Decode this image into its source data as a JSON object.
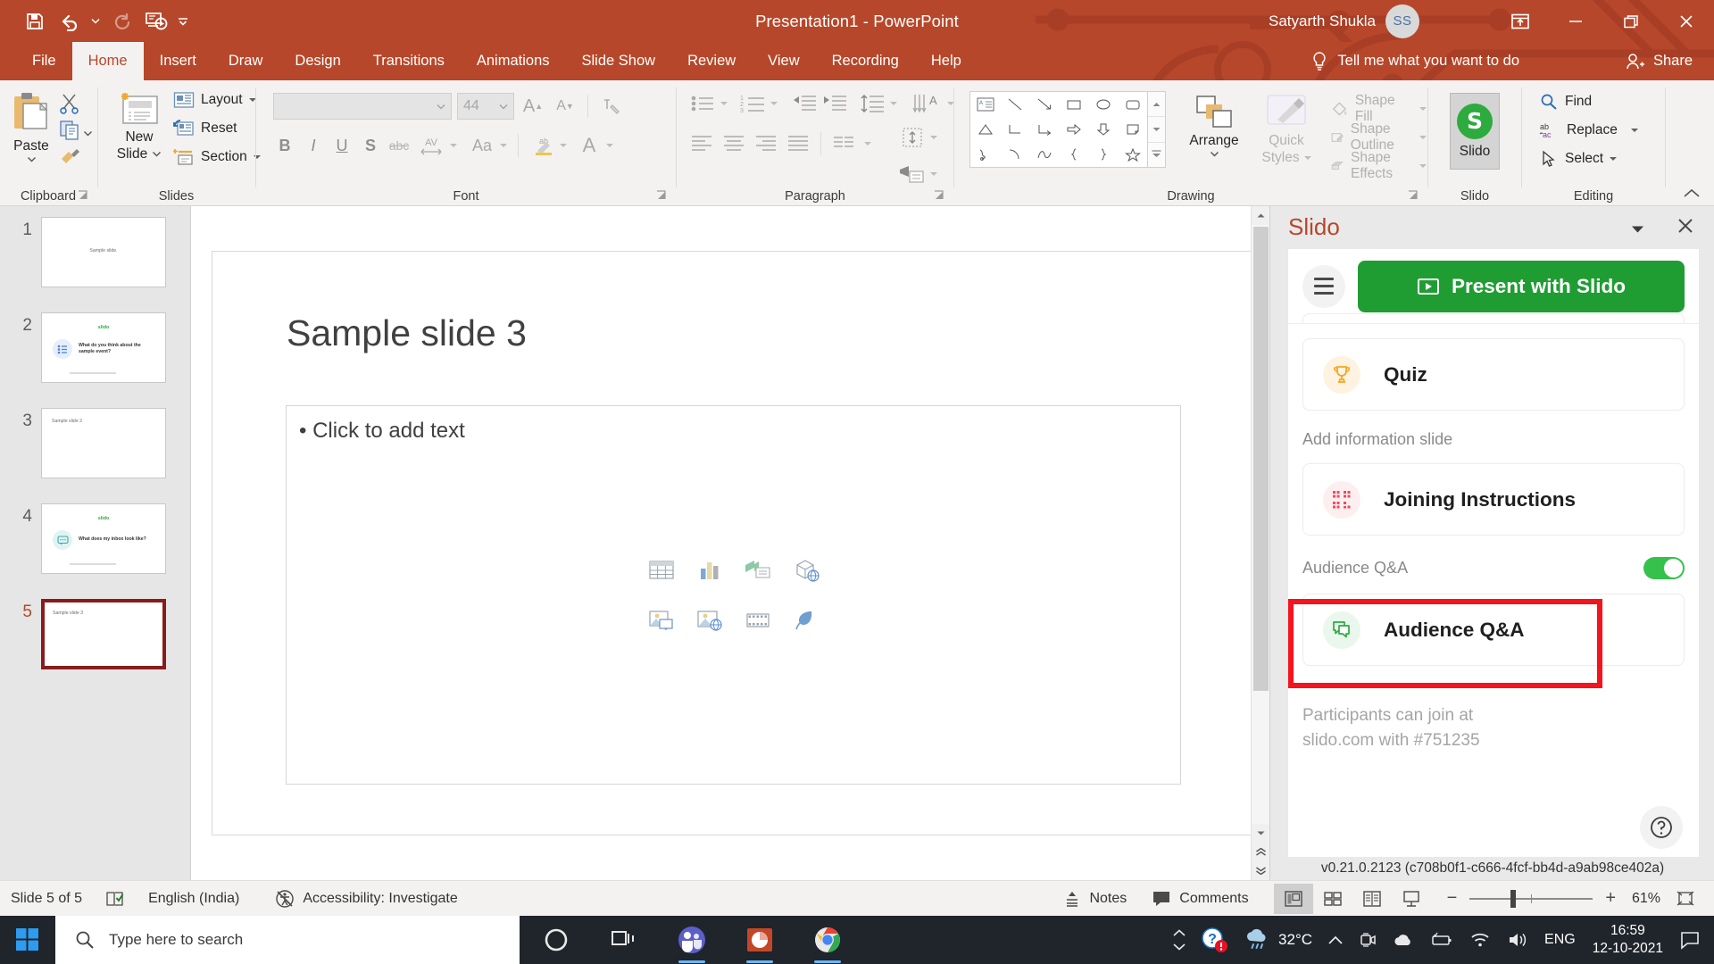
{
  "window": {
    "title": "Presentation1  -  PowerPoint",
    "account_name": "Satyarth Shukla",
    "avatar_initials": "SS",
    "brand_color": "#b7472a",
    "controls": {
      "ribbon_display_options": "ribbon-display-options",
      "minimize": "minimize",
      "restore": "restore",
      "close": "close"
    }
  },
  "quick_access": {
    "items": [
      "save",
      "undo",
      "undo-dropdown",
      "redo",
      "start-from-beginning",
      "customize-qat"
    ]
  },
  "ribbon": {
    "tabs": [
      {
        "label": "File",
        "active": false
      },
      {
        "label": "Home",
        "active": true
      },
      {
        "label": "Insert",
        "active": false
      },
      {
        "label": "Draw",
        "active": false
      },
      {
        "label": "Design",
        "active": false
      },
      {
        "label": "Transitions",
        "active": false
      },
      {
        "label": "Animations",
        "active": false
      },
      {
        "label": "Slide Show",
        "active": false
      },
      {
        "label": "Review",
        "active": false
      },
      {
        "label": "View",
        "active": false
      },
      {
        "label": "Recording",
        "active": false
      },
      {
        "label": "Help",
        "active": false
      }
    ],
    "tell_me": "Tell me what you want to do",
    "share": "Share",
    "groups": {
      "clipboard": {
        "label": "Clipboard",
        "paste": "Paste",
        "cut": "Cut",
        "copy": "Copy",
        "format_painter": "Format Painter"
      },
      "slides": {
        "label": "Slides",
        "new_slide": "New\nSlide",
        "new_slide_line1": "New",
        "new_slide_line2": "Slide",
        "layout": "Layout",
        "reset": "Reset",
        "section": "Section"
      },
      "font": {
        "label": "Font",
        "font_name": "",
        "font_name_placeholder": "",
        "font_size": "44",
        "buttons": [
          "Bold",
          "Italic",
          "Underline",
          "Text Shadow",
          "Strikethrough",
          "Character Spacing",
          "Change Case",
          "Text Highlight Color",
          "Font Color"
        ]
      },
      "paragraph": {
        "label": "Paragraph"
      },
      "drawing": {
        "label": "Drawing",
        "arrange": "Arrange",
        "quick_styles_line1": "Quick",
        "quick_styles_line2": "Styles",
        "shape_fill": "Shape Fill",
        "shape_outline": "Shape Outline",
        "shape_effects": "Shape Effects"
      },
      "slido": {
        "label": "Slido",
        "button_label": "Slido",
        "logo_letter": "S",
        "accent": "#2dab3e"
      },
      "editing": {
        "label": "Editing",
        "find": "Find",
        "replace": "Replace",
        "select": "Select"
      }
    }
  },
  "thumbnails": [
    {
      "number": "1",
      "title": "Sample slide.",
      "kind": "title",
      "selected": false
    },
    {
      "number": "2",
      "title": "",
      "kind": "slido-poll",
      "brand": "slido",
      "question": "What do you think about the sample event?",
      "selected": false
    },
    {
      "number": "3",
      "title": "Sample slide 2",
      "kind": "content",
      "selected": false
    },
    {
      "number": "4",
      "title": "",
      "kind": "slido-qa",
      "brand": "slido",
      "question": "What does my inbox look like?",
      "selected": false
    },
    {
      "number": "5",
      "title": "Sample slide 3",
      "kind": "content",
      "selected": true
    }
  ],
  "slide": {
    "title": "Sample slide 3",
    "body_placeholder": "• Click to add text",
    "placeholder_icons": [
      "table-icon",
      "chart-icon",
      "smartart-icon",
      "3d-model-icon",
      "pictures-icon",
      "stock-images-icon",
      "video-icon",
      "icons-icon"
    ]
  },
  "slido_panel": {
    "title": "Slido",
    "menu_caret": "chevron-down-icon",
    "close": "close-icon",
    "present_button": "Present with Slido",
    "cards": [
      {
        "label": "Quiz",
        "icon": "trophy-icon",
        "icon_color": "#f5a623",
        "icon_bg": "#fdf3e0",
        "highlighted": false
      },
      {
        "label": "Joining Instructions",
        "icon": "qr-code-icon",
        "icon_color": "#f2495c",
        "icon_bg": "#fdeef0",
        "highlighted": false
      },
      {
        "label": "Audience Q&A",
        "icon": "speech-bubbles-icon",
        "icon_color": "#2dab3e",
        "icon_bg": "#e9f7ec",
        "highlighted": true
      }
    ],
    "section_label": "Add information slide",
    "toggle_label": "Audience Q&A",
    "toggle_on": true,
    "toggle_color": "#35c14c",
    "footnote_line1": "Participants can join at",
    "footnote_line2": "slido.com with #751235",
    "help_icon": "question-circle-icon",
    "version": "v0.21.0.2123 (c708b0f1-c666-4fcf-bb4d-a9ab98ce402a)",
    "highlight_color": "#f5131d"
  },
  "status_bar": {
    "slide_count": "Slide 5 of 5",
    "spellcheck_icon": "spellcheck-icon",
    "language": "English (India)",
    "accessibility": "Accessibility: Investigate",
    "notes": "Notes",
    "comments": "Comments",
    "views": [
      "normal-view",
      "slide-sorter-view",
      "reading-view",
      "slide-show-view"
    ],
    "zoom_minus": "−",
    "zoom_plus": "+",
    "zoom_level": "61%",
    "fit_slide_icon": "fit-slide-to-window-icon"
  },
  "taskbar": {
    "start": "start-button",
    "search_placeholder": "Type here to search",
    "apps": [
      "cortana-icon",
      "task-view-icon",
      "teams-icon",
      "powerpoint-icon",
      "chrome-icon"
    ],
    "tray": {
      "notification": "help-notification-icon",
      "weather_temp": "32°C",
      "weather_icon": "rain-cloud-icon",
      "overflow": "show-hidden-icons",
      "icons": [
        "camera-icon",
        "onedrive-icon",
        "battery-icon",
        "wifi-icon",
        "volume-icon"
      ],
      "language": "ENG",
      "time": "16:59",
      "date": "12-10-2021",
      "action_center": "action-center-icon"
    }
  }
}
